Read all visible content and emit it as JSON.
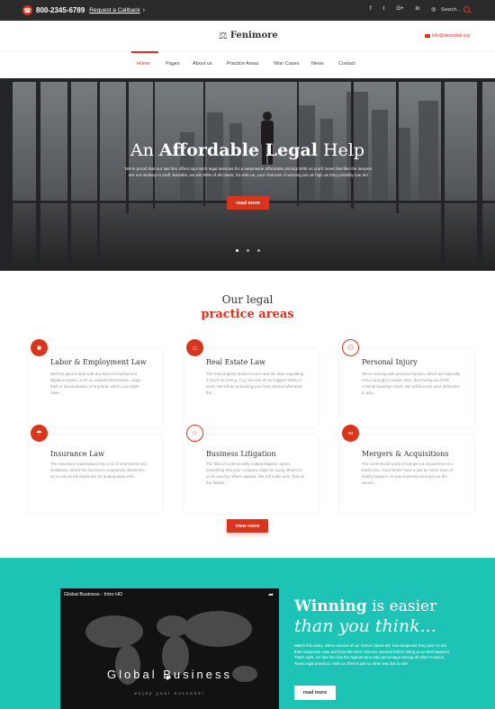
{
  "topbar": {
    "phone": "800-2345-6789",
    "callback": "Request a Callback",
    "socials": [
      "f",
      "t",
      "G+",
      "in",
      "◎"
    ],
    "search_placeholder": "Search..."
  },
  "header": {
    "logo": "Fenimore",
    "email": "info@demolink.org"
  },
  "nav": {
    "items": [
      "Home",
      "Pages",
      "About us",
      "Practice Areas",
      "Won Cases",
      "News",
      "Contact"
    ]
  },
  "hero": {
    "title_plain1": "An ",
    "title_bold": "Affordable Legal",
    "title_plain2": " Help",
    "text": "We're proud that our law firm offers top-notch legal services for a nationwide affordable pricing! With us you'll never feel like the lawyers are not midway to stuff. Besides, we win 98% of all cases. So with us, your chances of winning are as high as they possibly can be!",
    "button": "read more",
    "slides": 3,
    "active_slide": 0
  },
  "practice": {
    "title1": "Our legal",
    "title2": "practice areas",
    "cards": [
      {
        "title": "Labor & Employment Law",
        "icon": "briefcase-icon",
        "text": "We'll be glad to deal with any kind of employment litigation issues, such as unlawful termination, wage theft or discrimination of any kind, which you might have..."
      },
      {
        "title": "Real Estate Law",
        "icon": "house-icon",
        "text": "The real property market issues and the laws regulating it (such as zoning, e.g.) are one of our biggest fields of work. We will be protecting your best interest whenever the..."
      },
      {
        "title": "Personal Injury",
        "icon": "people-icon",
        "text": "We're working with personal injuries, which are basically minor wrongful conduct torts, thus being out of the criminal hearings reach. We will become your defenders in any..."
      },
      {
        "title": "Insurance Law",
        "icon": "umbrella-icon",
        "text": "The insurance marketplace has a lot of restrictions and limitations, which the insurance companies oftentimes try to use as the loopholes for getting away with..."
      },
      {
        "title": "Business Litigation",
        "icon": "star-icon",
        "text": "The field of commercially related litigation spans everything that your company might be suing others for or be sued by others against. We will make sure, that all the details..."
      },
      {
        "title": "Mergers & Acquisitions",
        "icon": "link-icon",
        "text": "The commercial world of mergers & acquisitions is a harsh one. You'd better have a just as harsh team of sharky lawyers on your business emerges as the winner..."
      }
    ],
    "button": "view more"
  },
  "promo": {
    "video_title": "Global Business - Intro HD",
    "video_heading": "Global Business",
    "video_sub": "enjoy your success!",
    "title_bold": "Winning",
    "title_rest": " is easier",
    "title2": "than you think...",
    "text": "Watch this video, where dozens of our former clients tell, how desperate they were to win their respective case and how slim their chances seemed before hiring us as their lawyers! That's right, our law firm has the highest wins ratio percentage among all other Houston, Texas legal practices. With us, there's just no other way but to win!",
    "button": "read more"
  },
  "colors": {
    "accent": "#d9341c",
    "teal": "#1dc3b5",
    "dark": "#2b2b2b"
  }
}
